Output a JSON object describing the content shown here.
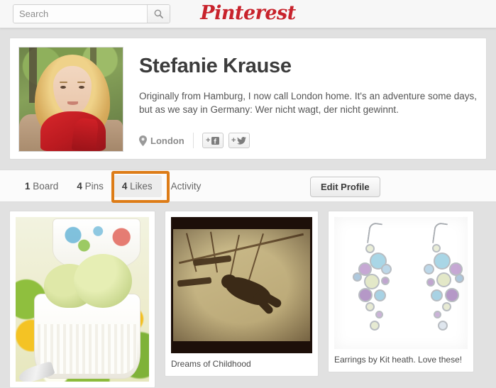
{
  "header": {
    "search": {
      "placeholder": "Search",
      "value": "",
      "icon": "search-icon"
    },
    "brand": {
      "logo_text": "Pinterest",
      "color": "#c8232c"
    }
  },
  "profile": {
    "avatar_alt": "portrait of a woman with curly blonde hair wearing a red scarf",
    "name": "Stefanie Krause",
    "bio": "Originally from Hamburg, I now call London home. It's an adventure some days, but as we say in Germany: Wer nicht wagt, der nicht gewinnt.",
    "location": {
      "icon": "map-pin-icon",
      "text": "London"
    },
    "social_buttons": [
      {
        "name": "connect-facebook",
        "icon": "facebook-icon",
        "prefix": "+"
      },
      {
        "name": "connect-twitter",
        "icon": "twitter-bird-icon",
        "prefix": "+"
      }
    ]
  },
  "tabs": [
    {
      "count": "1",
      "label": "Board",
      "active": false
    },
    {
      "count": "4",
      "label": "Pins",
      "active": false
    },
    {
      "count": "4",
      "label": "Likes",
      "active": true
    },
    {
      "count": "",
      "label": "Activity",
      "active": false
    }
  ],
  "actions": {
    "edit_profile_label": "Edit Profile"
  },
  "annotation": {
    "target": "4 Likes",
    "color": "#dd7c17"
  },
  "pins": [
    {
      "id": "pin-ice-cream",
      "caption": "",
      "image_alt": "green avocado ice cream scoops in a white ramekin on a floral tablecloth"
    },
    {
      "id": "pin-dreams-of-childhood",
      "caption": "Dreams of Childhood",
      "image_alt": "sepia photo of the shadow of a child on a swing"
    },
    {
      "id": "pin-earrings",
      "caption": "Earrings by Kit heath. Love these!",
      "image_alt": "silver drop earrings with pastel multicolour gemstones"
    }
  ]
}
